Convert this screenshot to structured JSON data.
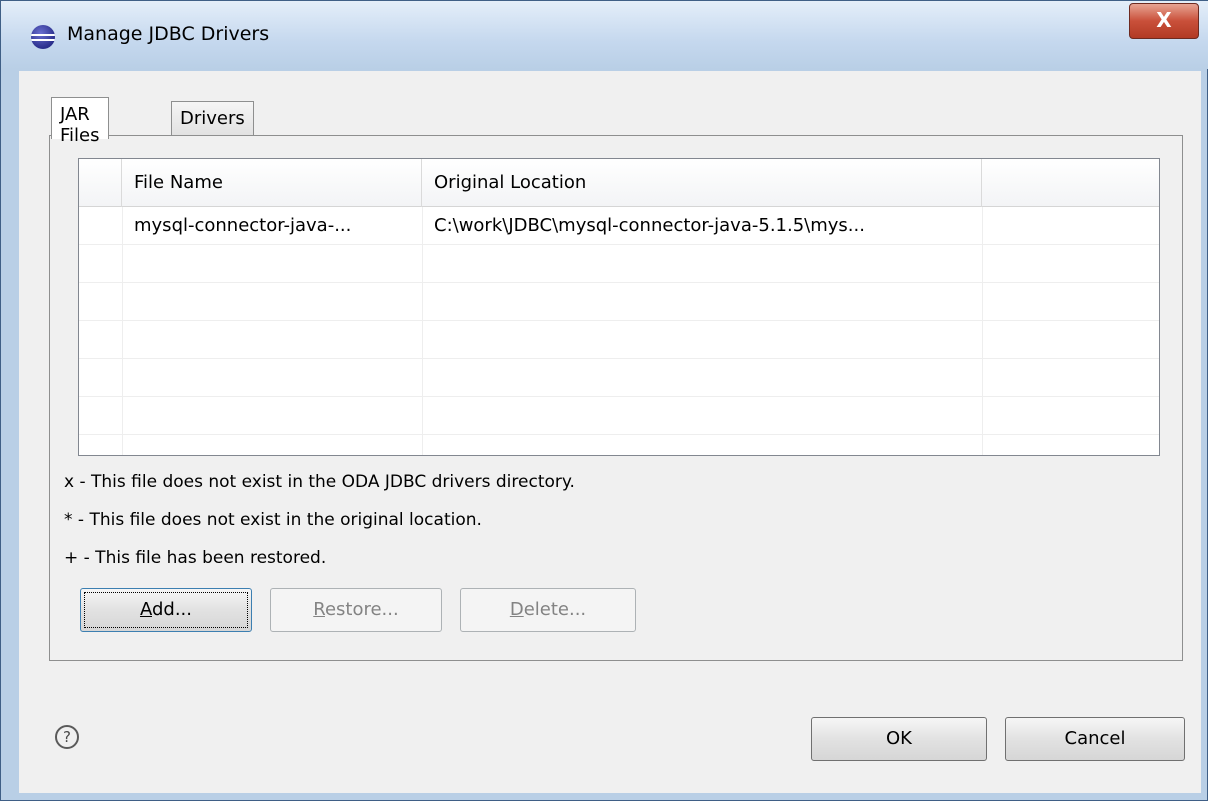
{
  "window": {
    "title": "Manage JDBC Drivers",
    "close_label": "X"
  },
  "tabs": [
    {
      "label": "JAR Files",
      "selected": true
    },
    {
      "label": "Drivers",
      "selected": false
    }
  ],
  "jar_table": {
    "columns": [
      "File Name",
      "Original Location",
      ""
    ],
    "rows": [
      [
        "mysql-connector-java-...",
        "C:\\work\\JDBC\\mysql-connector-java-5.1.5\\mys...",
        ""
      ]
    ]
  },
  "legend": [
    "x - This file does not exist in the ODA JDBC drivers directory.",
    "* - This file does not exist in the original location.",
    "+ - This file has been restored."
  ],
  "buttons": {
    "add": {
      "mnemonic": "A",
      "rest": "dd...",
      "enabled": true
    },
    "restore": {
      "mnemonic": "R",
      "rest": "estore...",
      "enabled": false
    },
    "delete": {
      "mnemonic": "D",
      "rest": "elete...",
      "enabled": false
    },
    "ok": "OK",
    "cancel": "Cancel"
  },
  "help": {
    "icon": "question-circle-icon",
    "glyph": "?"
  }
}
